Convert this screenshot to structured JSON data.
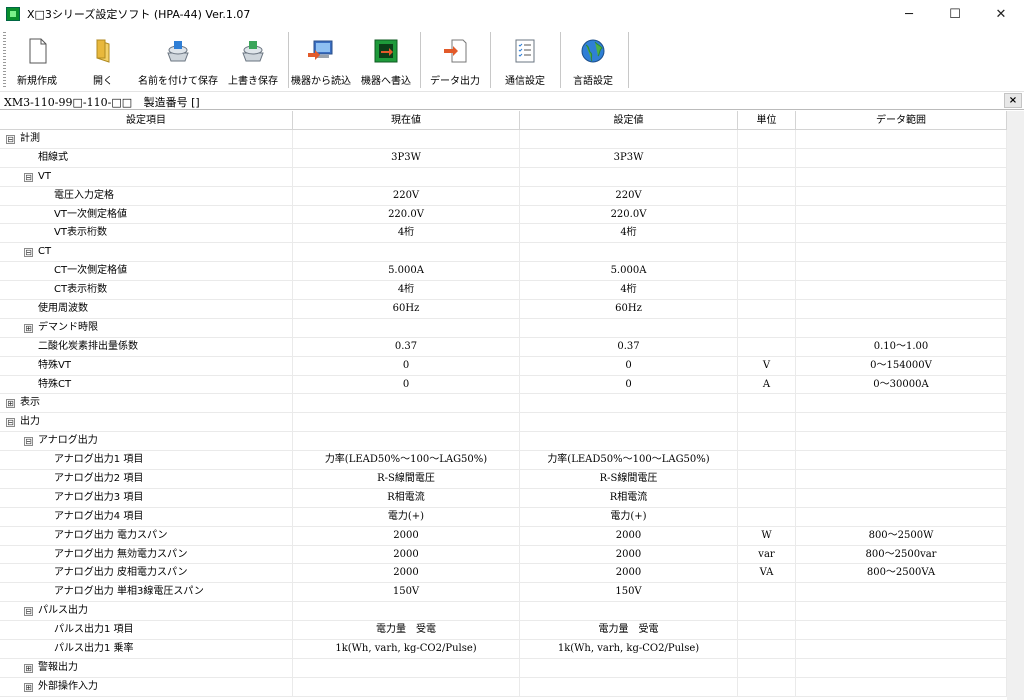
{
  "window": {
    "title": "X□3シリーズ設定ソフト (HPA-44) Ver.1.07",
    "minimize_glyph": "─",
    "maximize_glyph": "☐",
    "close_glyph": "✕"
  },
  "toolbar": {
    "items": [
      {
        "label": "新規作成",
        "icon": "new-document-icon"
      },
      {
        "label": "開く",
        "icon": "open-folder-icon"
      },
      {
        "label": "名前を付けて保存",
        "icon": "save-as-icon"
      },
      {
        "label": "上書き保存",
        "icon": "overwrite-save-icon"
      },
      {
        "label": "機器から読込",
        "icon": "read-from-device-icon"
      },
      {
        "label": "機器へ書込",
        "icon": "write-to-device-icon"
      },
      {
        "label": "データ出力",
        "icon": "data-export-icon"
      },
      {
        "label": "通信設定",
        "icon": "communication-settings-icon"
      },
      {
        "label": "言語設定",
        "icon": "globe-icon"
      }
    ]
  },
  "device": {
    "model": "XM3-110-99□-110-□□",
    "serial_label": "製造番号 []",
    "close_glyph": "×"
  },
  "grid": {
    "columns": [
      "設定項目",
      "現在値",
      "設定値",
      "単位",
      "データ範囲"
    ],
    "rows": [
      {
        "name": "計測",
        "level": 0,
        "toggle": "⊟",
        "cur": "",
        "set": "",
        "unit": "",
        "range": ""
      },
      {
        "name": "相線式",
        "level": 1,
        "toggle": "",
        "cur": "3P3W",
        "set": "3P3W",
        "unit": "",
        "range": ""
      },
      {
        "name": "VT",
        "level": 1,
        "toggle": "⊟",
        "cur": "",
        "set": "",
        "unit": "",
        "range": ""
      },
      {
        "name": "電圧入力定格",
        "level": 2,
        "toggle": "",
        "cur": "220V",
        "set": "220V",
        "unit": "",
        "range": ""
      },
      {
        "name": "VT一次側定格値",
        "level": 2,
        "toggle": "",
        "cur": "220.0V",
        "set": "220.0V",
        "unit": "",
        "range": ""
      },
      {
        "name": "VT表示桁数",
        "level": 2,
        "toggle": "",
        "cur": "4桁",
        "set": "4桁",
        "unit": "",
        "range": ""
      },
      {
        "name": "CT",
        "level": 1,
        "toggle": "⊟",
        "cur": "",
        "set": "",
        "unit": "",
        "range": ""
      },
      {
        "name": "CT一次側定格値",
        "level": 2,
        "toggle": "",
        "cur": "5.000A",
        "set": "5.000A",
        "unit": "",
        "range": ""
      },
      {
        "name": "CT表示桁数",
        "level": 2,
        "toggle": "",
        "cur": "4桁",
        "set": "4桁",
        "unit": "",
        "range": ""
      },
      {
        "name": "使用周波数",
        "level": 1,
        "toggle": "",
        "cur": "60Hz",
        "set": "60Hz",
        "unit": "",
        "range": ""
      },
      {
        "name": "デマンド時限",
        "level": 1,
        "toggle": "⊞",
        "cur": "",
        "set": "",
        "unit": "",
        "range": ""
      },
      {
        "name": "二酸化炭素排出量係数",
        "level": 1,
        "toggle": "",
        "cur": "0.37",
        "set": "0.37",
        "unit": "",
        "range": "0.10～1.00"
      },
      {
        "name": "特殊VT",
        "level": 1,
        "toggle": "",
        "cur": "0",
        "set": "0",
        "unit": "V",
        "range": "0～154000V"
      },
      {
        "name": "特殊CT",
        "level": 1,
        "toggle": "",
        "cur": "0",
        "set": "0",
        "unit": "A",
        "range": "0～30000A"
      },
      {
        "name": "表示",
        "level": 0,
        "toggle": "⊞",
        "cur": "",
        "set": "",
        "unit": "",
        "range": ""
      },
      {
        "name": "出力",
        "level": 0,
        "toggle": "⊟",
        "cur": "",
        "set": "",
        "unit": "",
        "range": ""
      },
      {
        "name": "アナログ出力",
        "level": 1,
        "toggle": "⊟",
        "cur": "",
        "set": "",
        "unit": "",
        "range": ""
      },
      {
        "name": "アナログ出力1 項目",
        "level": 2,
        "toggle": "",
        "cur": "力率(LEAD50%～100～LAG50%)",
        "set": "力率(LEAD50%～100～LAG50%)",
        "unit": "",
        "range": ""
      },
      {
        "name": "アナログ出力2 項目",
        "level": 2,
        "toggle": "",
        "cur": "R-S線間電圧",
        "set": "R-S線間電圧",
        "unit": "",
        "range": ""
      },
      {
        "name": "アナログ出力3 項目",
        "level": 2,
        "toggle": "",
        "cur": "R相電流",
        "set": "R相電流",
        "unit": "",
        "range": ""
      },
      {
        "name": "アナログ出力4 項目",
        "level": 2,
        "toggle": "",
        "cur": "電力(+)",
        "set": "電力(+)",
        "unit": "",
        "range": ""
      },
      {
        "name": "アナログ出力 電力スパン",
        "level": 2,
        "toggle": "",
        "cur": "2000",
        "set": "2000",
        "unit": "W",
        "range": "800～2500W"
      },
      {
        "name": "アナログ出力 無効電力スパン",
        "level": 2,
        "toggle": "",
        "cur": "2000",
        "set": "2000",
        "unit": "var",
        "range": "800～2500var"
      },
      {
        "name": "アナログ出力 皮相電力スパン",
        "level": 2,
        "toggle": "",
        "cur": "2000",
        "set": "2000",
        "unit": "VA",
        "range": "800～2500VA"
      },
      {
        "name": "アナログ出力 単相3線電圧スパン",
        "level": 2,
        "toggle": "",
        "cur": "150V",
        "set": "150V",
        "unit": "",
        "range": ""
      },
      {
        "name": "パルス出力",
        "level": 1,
        "toggle": "⊟",
        "cur": "",
        "set": "",
        "unit": "",
        "range": ""
      },
      {
        "name": "パルス出力1 項目",
        "level": 2,
        "toggle": "",
        "cur": "電力量　受電",
        "set": "電力量　受電",
        "unit": "",
        "range": ""
      },
      {
        "name": "パルス出力1 乗率",
        "level": 2,
        "toggle": "",
        "cur": "1k(Wh, varh, kg-CO2/Pulse)",
        "set": "1k(Wh, varh, kg-CO2/Pulse)",
        "unit": "",
        "range": ""
      },
      {
        "name": "警報出力",
        "level": 1,
        "toggle": "⊞",
        "cur": "",
        "set": "",
        "unit": "",
        "range": ""
      },
      {
        "name": "外部操作入力",
        "level": 1,
        "toggle": "⊞",
        "cur": "",
        "set": "",
        "unit": "",
        "range": ""
      }
    ]
  }
}
